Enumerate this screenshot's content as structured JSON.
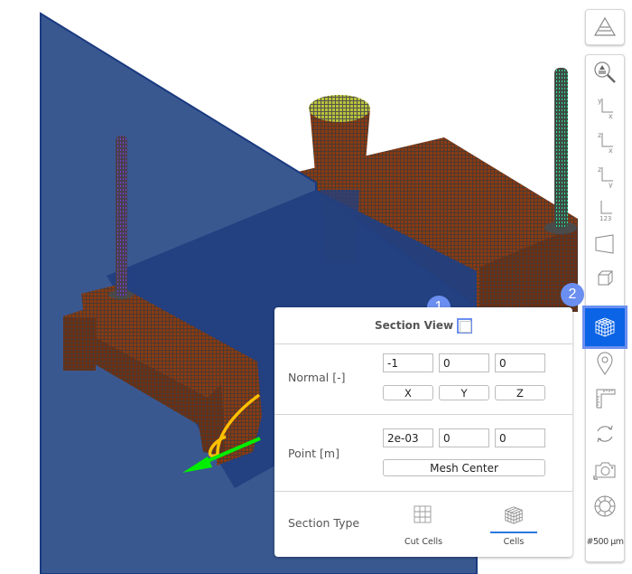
{
  "toolbar": {
    "buttons": [
      {
        "id": "layers",
        "icon": "layers-icon",
        "tooltip": ""
      },
      {
        "id": "zoom-fit",
        "icon": "zoom-fit-icon"
      },
      {
        "id": "view-xy",
        "icon": "axis-xy-icon",
        "axes": [
          "y",
          "x"
        ]
      },
      {
        "id": "view-xz",
        "icon": "axis-xz-icon",
        "axes": [
          "z",
          "x"
        ]
      },
      {
        "id": "view-yz",
        "icon": "axis-yz-icon",
        "axes": [
          "z",
          "y"
        ]
      },
      {
        "id": "view-iso",
        "icon": "axis-iso-icon",
        "axes": [
          "123"
        ]
      },
      {
        "id": "perspective",
        "icon": "perspective-icon"
      },
      {
        "id": "orthographic",
        "icon": "cube-icon"
      },
      {
        "id": "section-view",
        "icon": "section-cube-icon",
        "active": true
      },
      {
        "id": "probe",
        "icon": "map-pin-icon"
      },
      {
        "id": "ruler",
        "icon": "ruler-icon"
      },
      {
        "id": "rotate",
        "icon": "rotate-icon"
      },
      {
        "id": "screenshot",
        "icon": "camera-icon"
      },
      {
        "id": "lifebuoy",
        "icon": "lifebuoy-icon"
      }
    ],
    "scale_label": "#500 µm"
  },
  "badges": {
    "one": "1",
    "two": "2"
  },
  "panel": {
    "title": "Section View",
    "section_view_checked": false,
    "normal": {
      "label": "Normal [-]",
      "values": [
        "-1",
        "0",
        "0"
      ],
      "buttons": [
        "X",
        "Y",
        "Z"
      ]
    },
    "point": {
      "label": "Point [m]",
      "values": [
        "2e-03",
        "0",
        "0"
      ],
      "mesh_center_label": "Mesh Center"
    },
    "section_type": {
      "label": "Section Type",
      "options": [
        {
          "label": "Cut Cells",
          "icon": "grid-icon",
          "selected": false
        },
        {
          "label": "Cells",
          "icon": "cube-cells-icon",
          "selected": true
        }
      ]
    }
  },
  "colors": {
    "accent": "#0b63e5",
    "badge": "#6b8ff0",
    "section_plane": "#3a5890",
    "mesh_copper": "#8a3a12",
    "mesh_dark": "#4a4a4a",
    "selection_underline": "#2a78e0"
  }
}
